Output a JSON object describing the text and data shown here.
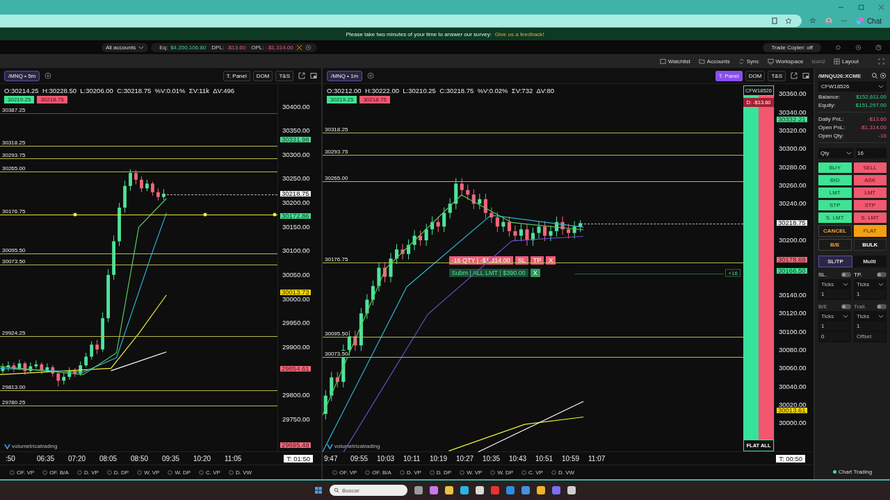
{
  "browser": {
    "chat_label": "Chat"
  },
  "banner": {
    "text": "Please take two minutes of your time to answer our survey:",
    "link": "Give us a feedback!"
  },
  "account_bar": {
    "account": "All accounts",
    "stats": [
      {
        "label": "Eq:",
        "value": "$4,350,106.80",
        "kind": "up"
      },
      {
        "label": "DPL:",
        "value": "-$13.60",
        "kind": "down"
      },
      {
        "label": "OPL:",
        "value": "-$1,314.00",
        "kind": "down"
      }
    ],
    "trade_copier": "Trade Copier: off"
  },
  "toolbar": [
    {
      "label": "Watchlist",
      "kind": "list",
      "disabled": false
    },
    {
      "label": "Accounts",
      "kind": "folder",
      "disabled": false
    },
    {
      "label": "Sync",
      "kind": "sync",
      "disabled": false
    },
    {
      "label": "Workspace",
      "kind": "monitor",
      "disabled": false
    },
    {
      "label": "Icon2",
      "kind": "none",
      "disabled": true
    },
    {
      "label": "Layout",
      "kind": "grid",
      "disabled": false
    }
  ],
  "charts": [
    {
      "symbol": "/MNQ • 5m",
      "buttons": [
        {
          "label": "T. Panel",
          "selected": false
        },
        {
          "label": "DOM",
          "selected": false
        },
        {
          "label": "T&S",
          "selected": false
        }
      ],
      "ohlc": "O:30214.25  H:30228.50  L:30206.00  C:30218.75  %V:0.01%  ΣV:11k  ΔV:496",
      "bid": "30219.25",
      "ask": "30218.75",
      "chart_data": {
        "type": "candlestick",
        "ylim": [
          29683,
          30447
        ],
        "yticks": [
          {
            "value": 30400,
            "label": "30400.00"
          },
          {
            "value": 30350,
            "label": "30350.00"
          },
          {
            "value": 30300,
            "label": "30300.00"
          },
          {
            "value": 30250,
            "label": "30250.00"
          },
          {
            "value": 30200,
            "label": "30200.00"
          },
          {
            "value": 30150,
            "label": "30150.00"
          },
          {
            "value": 30100,
            "label": "30100.00"
          },
          {
            "value": 30050,
            "label": "30050.00"
          },
          {
            "value": 30000,
            "label": "30000.00"
          },
          {
            "value": 29950,
            "label": "29950.00"
          },
          {
            "value": 29900,
            "label": "29900.00"
          },
          {
            "value": 29800,
            "label": "29800.00"
          },
          {
            "value": 29750,
            "label": "29750.00"
          }
        ],
        "categories": [
          null,
          null,
          null,
          null,
          null,
          null,
          null,
          null,
          null,
          null,
          null,
          null,
          null,
          null,
          null,
          null,
          null,
          null,
          null,
          null,
          null,
          null,
          null,
          null,
          null,
          null,
          null,
          null,
          null,
          null,
          null,
          null,
          null,
          null,
          null,
          null,
          null,
          null,
          null,
          null,
          null,
          null,
          null,
          null,
          null,
          null,
          null,
          null,
          null,
          null
        ],
        "ohlc": [
          [
            29850,
            29866,
            29845,
            29858
          ],
          [
            29858,
            29870,
            29850,
            29862
          ],
          [
            29862,
            29868,
            29848,
            29855
          ],
          [
            29855,
            29874,
            29852,
            29866
          ],
          [
            29866,
            29870,
            29842,
            29850
          ],
          [
            29850,
            29868,
            29846,
            29860
          ],
          [
            29860,
            29872,
            29855,
            29864
          ],
          [
            29864,
            29868,
            29844,
            29852
          ],
          [
            29852,
            29866,
            29848,
            29858
          ],
          [
            29858,
            29862,
            29838,
            29845
          ],
          [
            29845,
            29850,
            29818,
            29830
          ],
          [
            29830,
            29846,
            29822,
            29838
          ],
          [
            29838,
            29858,
            29832,
            29850
          ],
          [
            29850,
            29856,
            29838,
            29845
          ],
          [
            29845,
            29870,
            29840,
            29862
          ],
          [
            29862,
            29888,
            29858,
            29880
          ],
          [
            29880,
            29912,
            29874,
            29905
          ],
          [
            29905,
            29915,
            29885,
            29895
          ],
          [
            29895,
            29972,
            29890,
            29960
          ],
          [
            29960,
            30062,
            29952,
            30050
          ],
          [
            30050,
            30132,
            30040,
            30120
          ],
          [
            30120,
            30200,
            30110,
            30190
          ],
          [
            30190,
            30246,
            30180,
            30235
          ],
          [
            30235,
            30270,
            30225,
            30262
          ],
          [
            30262,
            30268,
            30238,
            30248
          ],
          [
            30248,
            30255,
            30222,
            30230
          ],
          [
            30230,
            30248,
            30224,
            30240
          ],
          [
            30240,
            30244,
            30215,
            30222
          ],
          [
            30222,
            30230,
            30205,
            30212
          ],
          [
            30212,
            30228.5,
            30206,
            30218.75
          ],
          null,
          null,
          null,
          null,
          null,
          null,
          null,
          null,
          null,
          null,
          null,
          null,
          null,
          null,
          null,
          null,
          null,
          null,
          null,
          null
        ]
      },
      "levels": [
        {
          "price": "30387.25",
          "color": "#2f6b3a",
          "kind": "line"
        },
        {
          "price": "30318.25",
          "color": "#b9b94a",
          "kind": "line"
        },
        {
          "price": "30293.75",
          "color": "#b9b94a",
          "kind": "line"
        },
        {
          "price": "30265.00",
          "color": "#b9b94a",
          "kind": "line"
        },
        {
          "price": "30176.75",
          "color": "#e8e830",
          "kind": "alert"
        },
        {
          "price": "30095.50",
          "color": "#b9b94a",
          "kind": "line"
        },
        {
          "price": "30073.50",
          "color": "#b9b94a",
          "kind": "line"
        },
        {
          "price": "29924.25",
          "color": "#b9b94a",
          "kind": "line"
        },
        {
          "price": "29813.00",
          "color": "#b9b94a",
          "kind": "line"
        },
        {
          "price": "29780.25",
          "color": "#b9b94a",
          "kind": "line"
        }
      ],
      "tags": [
        {
          "price": "30331.98",
          "kind": "green"
        },
        {
          "price": "30218.75",
          "kind": "white"
        },
        {
          "price": "30172.86",
          "kind": "green"
        },
        {
          "price": "30013.73",
          "kind": "yellow"
        },
        {
          "price": "29854.61",
          "kind": "red"
        },
        {
          "price": "29695.48",
          "kind": "red"
        }
      ],
      "times": [
        ":50",
        "06:35",
        "07:20",
        "08:05",
        "08:50",
        "09:35",
        "10:20",
        "11:05"
      ],
      "timer": "T: 01:50",
      "logo": "volumetricatrading",
      "toggles": [
        {
          "label": "OF. VP",
          "checked": false
        },
        {
          "label": "OF. B/A",
          "checked": false
        },
        {
          "label": "D. VP",
          "checked": false
        },
        {
          "label": "D. DP",
          "checked": false
        },
        {
          "label": "W. VP",
          "checked": false
        },
        {
          "label": "W. DP",
          "checked": false
        },
        {
          "label": "C. VP",
          "checked": false
        },
        {
          "label": "D. VW",
          "checked": false
        }
      ]
    },
    {
      "symbol": "/MNQ • 1m",
      "buttons": [
        {
          "label": "T. Panel",
          "selected": true
        },
        {
          "label": "DOM",
          "selected": false
        },
        {
          "label": "T&S",
          "selected": false
        }
      ],
      "ohlc": "O:30212.00  H:30222.00  L:30210.25  C:30218.75  %V:0.02%  ΣV:732  ΔV:80",
      "bid": "30219.25",
      "ask": "30218.75",
      "chart_data": {
        "type": "candlestick",
        "ylim": [
          29969,
          30371
        ],
        "yticks": [
          {
            "value": 30360,
            "label": "30360.00"
          },
          {
            "value": 30340,
            "label": "30340.00"
          },
          {
            "value": 30320,
            "label": "30320.00"
          },
          {
            "value": 30300,
            "label": "30300.00"
          },
          {
            "value": 30280,
            "label": "30280.00"
          },
          {
            "value": 30260,
            "label": "30260.00"
          },
          {
            "value": 30240,
            "label": "30240.00"
          },
          {
            "value": 30200,
            "label": "30200.00"
          },
          {
            "value": 30140,
            "label": "30140.00"
          },
          {
            "value": 30120,
            "label": "30120.00"
          },
          {
            "value": 30100,
            "label": "30100.00"
          },
          {
            "value": 30080,
            "label": "30080.00"
          },
          {
            "value": 30060,
            "label": "30060.00"
          },
          {
            "value": 30040,
            "label": "30040.00"
          },
          {
            "value": 30020,
            "label": "30020.00"
          },
          {
            "value": 30000,
            "label": "30000.00"
          }
        ],
        "categories": [
          null,
          null,
          null,
          null,
          null,
          null,
          null,
          null,
          null,
          null,
          null,
          null,
          null,
          null,
          null,
          null,
          null,
          null,
          null,
          null,
          null,
          null,
          null,
          null,
          null,
          null,
          null,
          null,
          null,
          null,
          null,
          null,
          null,
          null,
          null,
          null,
          null,
          null,
          null,
          null,
          null,
          null,
          null,
          null,
          null,
          null,
          null,
          null,
          null,
          null,
          null,
          null,
          null,
          null,
          null,
          null,
          null,
          null,
          null,
          null,
          null,
          null,
          null,
          null,
          null,
          null,
          null,
          null,
          null,
          null,
          null
        ],
        "ohlc": [
          [
            30010,
            30036,
            30004,
            30030
          ],
          [
            30030,
            30056,
            30024,
            30050
          ],
          [
            30050,
            30056,
            30039,
            30045
          ],
          [
            30045,
            30086,
            30039,
            30080
          ],
          [
            30080,
            30101,
            30074,
            30095
          ],
          [
            30095,
            30101,
            30079,
            30085
          ],
          [
            30085,
            30126,
            30079,
            30120
          ],
          [
            30120,
            30141,
            30114,
            30135
          ],
          [
            30135,
            30156,
            30129,
            30150
          ],
          [
            30150,
            30176,
            30144,
            30170
          ],
          [
            30170,
            30176,
            30154,
            30160
          ],
          [
            30160,
            30186,
            30154,
            30180
          ],
          [
            30180,
            30196,
            30174,
            30190
          ],
          [
            30190,
            30196,
            30179,
            30185
          ],
          [
            30185,
            30201,
            30179,
            30195
          ],
          [
            30195,
            30211,
            30189,
            30205
          ],
          [
            30205,
            30211,
            30194,
            30200
          ],
          [
            30200,
            30218,
            30194,
            30212
          ],
          [
            30212,
            30226,
            30206,
            30220
          ],
          [
            30220,
            30226,
            30209,
            30215
          ],
          [
            30215,
            30236,
            30209,
            30230
          ],
          [
            30230,
            30246,
            30224,
            30240
          ],
          [
            30240,
            30268,
            30234,
            30262
          ],
          [
            30262,
            30268,
            30249,
            30255
          ],
          [
            30255,
            30261,
            30244,
            30250
          ],
          [
            30250,
            30256,
            30234,
            30240
          ],
          [
            30240,
            30251,
            30234,
            30245
          ],
          [
            30245,
            30251,
            30224,
            30230
          ],
          [
            30230,
            30236,
            30219,
            30225
          ],
          [
            30225,
            30231,
            30209,
            30215
          ],
          [
            30215,
            30226,
            30209,
            30220
          ],
          [
            30220,
            30226,
            30204,
            30210
          ],
          [
            30210,
            30216,
            30199,
            30205
          ],
          [
            30205,
            30218,
            30199,
            30212
          ],
          [
            30212,
            30218,
            30194,
            30200
          ],
          [
            30200,
            30214,
            30194,
            30208
          ],
          [
            30208,
            30221,
            30202,
            30215
          ],
          [
            30215,
            30221,
            30199,
            30205
          ],
          [
            30205,
            30216,
            30199,
            30210
          ],
          [
            30210,
            30226,
            30204,
            30220
          ],
          [
            30220,
            30226,
            30206,
            30212
          ],
          [
            30212,
            30218,
            30202,
            30208
          ],
          [
            30208,
            30221,
            30202,
            30215
          ],
          [
            30215,
            30222,
            30209,
            30218.75
          ],
          null,
          null,
          null,
          null,
          null,
          null,
          null,
          null,
          null,
          null,
          null,
          null,
          null,
          null,
          null,
          null,
          null,
          null,
          null,
          null,
          null,
          null,
          null,
          null,
          null,
          null,
          null
        ]
      },
      "levels": [
        {
          "price": "30318.25",
          "color": "#b9b94a",
          "kind": "line"
        },
        {
          "price": "30293.75",
          "color": "#b9b94a",
          "kind": "line"
        },
        {
          "price": "30265.00",
          "color": "#b9b94a",
          "kind": "line"
        },
        {
          "price": "30176.75",
          "color": "#b9b94a",
          "kind": "line"
        },
        {
          "price": "30095.50",
          "color": "#b9b94a",
          "kind": "line"
        },
        {
          "price": "30073.50",
          "color": "#b9b94a",
          "kind": "line"
        }
      ],
      "tags": [
        {
          "price": "30332.21",
          "kind": "green"
        },
        {
          "price": "30218.75",
          "kind": "white"
        },
        {
          "price": "30178.69",
          "kind": "red"
        },
        {
          "price": "30166.50",
          "kind": "green"
        },
        {
          "price": "30013.61",
          "kind": "yellow"
        }
      ],
      "times": [
        "9:47",
        "09:55",
        "10:03",
        "10:11",
        "10:19",
        "10:27",
        "10:35",
        "10:43",
        "10:51",
        "10:59",
        "11:07"
      ],
      "timer": "T: 00:50",
      "logo": "volumetricatrading",
      "dom": {
        "account": "CFW18526",
        "pnl": "D: -$13.60",
        "flat": "FLAT ALL"
      },
      "order": {
        "text": "-16 QTY | -$1,314.00",
        "actions": [
          "SL",
          "TP",
          "X"
        ]
      },
      "pending": {
        "text": "Subm | ALL LMT | $390.00",
        "close": "X"
      },
      "position": "+16",
      "toggles": [
        {
          "label": "OF. VP",
          "checked": false
        },
        {
          "label": "OF. B/A",
          "checked": false
        },
        {
          "label": "D. VP",
          "checked": false
        },
        {
          "label": "D. DP",
          "checked": false
        },
        {
          "label": "W. VP",
          "checked": false
        },
        {
          "label": "W. DP",
          "checked": false
        },
        {
          "label": "C. VP",
          "checked": false
        },
        {
          "label": "D. VW",
          "checked": false
        }
      ]
    }
  ],
  "trade_panel": {
    "symbol": "/MNQU26:XCME",
    "account": "CFW18526",
    "stats": [
      {
        "label": "Balance:",
        "value": "$152,611.00",
        "kind": "up"
      },
      {
        "label": "Equity:",
        "value": "$151,297.00",
        "kind": "up"
      }
    ],
    "pnl": [
      {
        "label": "Daily PnL:",
        "value": "-$13.60",
        "kind": "down"
      },
      {
        "label": "Open PnL:",
        "value": "-$1,314.00",
        "kind": "down"
      },
      {
        "label": "Open Qty:",
        "value": "-16",
        "kind": "down"
      }
    ],
    "qty_mode": "Qty",
    "qty": "16",
    "order_buttons": [
      {
        "label": "BUY",
        "kind": "buy"
      },
      {
        "label": "SELL",
        "kind": "sell"
      },
      {
        "label": "BID",
        "kind": "buy"
      },
      {
        "label": "ASK",
        "kind": "sell"
      },
      {
        "label": "LMT",
        "kind": "buy"
      },
      {
        "label": "LMT",
        "kind": "sell"
      },
      {
        "label": "STP",
        "kind": "buy"
      },
      {
        "label": "STP",
        "kind": "sell"
      },
      {
        "label": "S. LMT",
        "kind": "buy"
      },
      {
        "label": "S. LMT",
        "kind": "sell"
      },
      {
        "label": "CANCEL",
        "kind": "outline"
      },
      {
        "label": "FLAT",
        "kind": "flat"
      },
      {
        "label": "B/E",
        "kind": "outline"
      },
      {
        "label": "BULK",
        "kind": "plain"
      }
    ],
    "tabs": [
      {
        "label": "SL/TP",
        "selected": true
      },
      {
        "label": "Multi",
        "selected": false
      }
    ],
    "brackets": [
      {
        "label": "SL.",
        "on": false,
        "disabled": false,
        "unit": "Ticks",
        "values": [
          "1"
        ]
      },
      {
        "label": "TP.",
        "on": false,
        "disabled": false,
        "unit": "Ticks",
        "values": [
          "1"
        ]
      },
      {
        "label": "B/E",
        "on": false,
        "disabled": true,
        "unit": "Ticks",
        "values": [
          "1",
          "0"
        ]
      },
      {
        "label": "Trail.",
        "on": false,
        "disabled": true,
        "unit": "Ticks",
        "values": [
          "1"
        ],
        "placeholder": "Offset"
      }
    ],
    "footer": "Chart Trading"
  },
  "taskbar": {
    "placeholder": "Buscar",
    "apps": [
      {
        "color": "#9a9a9a"
      },
      {
        "color": "#c87be8"
      },
      {
        "color": "#f0c040"
      },
      {
        "color": "#2bb3e8"
      },
      {
        "color": "#d9d9d9"
      },
      {
        "color": "#e8332f"
      },
      {
        "color": "#2d8de0"
      },
      {
        "color": "#4a8fe0"
      },
      {
        "color": "#f0b32a"
      },
      {
        "color": "#7a6ff0"
      },
      {
        "color": "#cfcfcf"
      }
    ]
  }
}
